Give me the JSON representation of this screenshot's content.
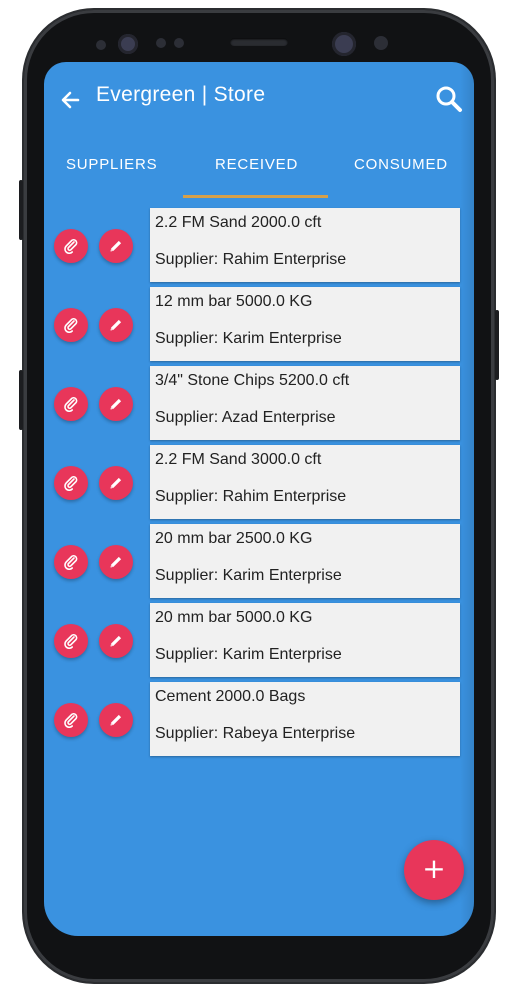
{
  "appbar": {
    "title": "Evergreen | Store",
    "back_icon": "arrow-left-icon",
    "search_icon": "search-icon"
  },
  "tabs": [
    {
      "label": "SUPPLIERS",
      "selected": false
    },
    {
      "label": "RECEIVED",
      "selected": true
    },
    {
      "label": "CONSUMED",
      "selected": false
    }
  ],
  "items": [
    {
      "title": "2.2 FM Sand 2000.0 cft",
      "supplier": "Supplier: Rahim Enterprise"
    },
    {
      "title": "12 mm bar 5000.0 KG",
      "supplier": "Supplier: Karim Enterprise"
    },
    {
      "title": "3/4\" Stone Chips 5200.0 cft",
      "supplier": "Supplier: Azad Enterprise"
    },
    {
      "title": "2.2 FM Sand 3000.0 cft",
      "supplier": "Supplier: Rahim Enterprise"
    },
    {
      "title": "20 mm bar 2500.0 KG",
      "supplier": "Supplier: Karim Enterprise"
    },
    {
      "title": "20 mm bar 5000.0 KG",
      "supplier": "Supplier: Karim Enterprise"
    },
    {
      "title": "Cement 2000.0 Bags",
      "supplier": "Supplier: Rabeya Enterprise"
    }
  ],
  "fab": {
    "label": "+",
    "icon": "plus-icon"
  },
  "colors": {
    "primary": "#3a92e0",
    "accent": "#e8365a",
    "indicator": "#d6a04a",
    "card": "#f1f1f1"
  }
}
